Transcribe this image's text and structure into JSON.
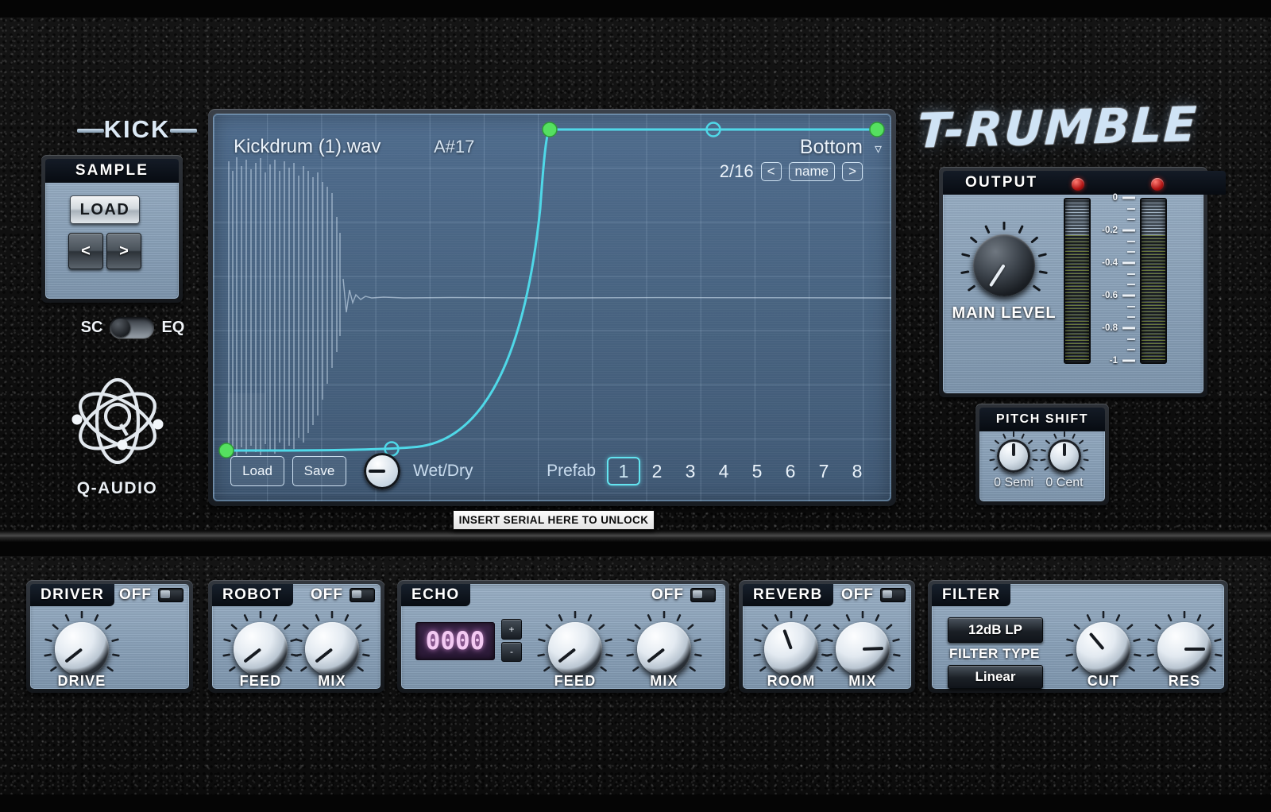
{
  "brand": {
    "plugin_name": "T-RUMBLE",
    "vendor": "Q-AUDIO",
    "vendor_icon": "atom-icon"
  },
  "kick": {
    "title": "KICK",
    "sample_header": "SAMPLE",
    "load_label": "LOAD",
    "prev_label": "<",
    "next_label": ">",
    "toggle_left": "SC",
    "toggle_right": "EQ",
    "toggle_state": "SC"
  },
  "display": {
    "wave_filename": "Kickdrum (1).wav",
    "note": "A#17",
    "preset_name": "Bottom",
    "preset_index": "2/16",
    "preset_prev": "<",
    "preset_name_button": "name",
    "preset_next": ">",
    "caret_icon": "chevron-down-icon",
    "load_label": "Load",
    "save_label": "Save",
    "wetdry_label": "Wet/Dry",
    "prefab_label": "Prefab",
    "prefab_buttons": [
      "1",
      "2",
      "3",
      "4",
      "5",
      "6",
      "7",
      "8"
    ],
    "prefab_selected": "1",
    "curve_color": "#4fd8e8",
    "node_color": "#55e060"
  },
  "serial": {
    "text": "INSERT SERIAL HERE TO UNLOCK"
  },
  "output": {
    "header": "OUTPUT",
    "knob_label": "MAIN LEVEL",
    "led_left": "clip-led",
    "led_right": "clip-led",
    "scale": [
      "0",
      "-0.2",
      "-0.4",
      "-0.6",
      "-0.8",
      "-1"
    ]
  },
  "pitch_shift": {
    "header": "PITCH SHIFT",
    "semi_value": "0 Semi",
    "cent_value": "0 Cent"
  },
  "effects": [
    {
      "name": "DRIVER",
      "power_label": "OFF",
      "power_state": "off",
      "knobs": [
        {
          "label": "DRIVE",
          "angle": -128
        }
      ]
    },
    {
      "name": "ROBOT",
      "power_label": "OFF",
      "power_state": "off",
      "knobs": [
        {
          "label": "FEED",
          "angle": -128
        },
        {
          "label": "MIX",
          "angle": -128
        }
      ]
    },
    {
      "name": "ECHO",
      "power_label": "OFF",
      "power_state": "off",
      "lcd_value": "0000",
      "lcd_inc": "+",
      "lcd_dec": "-",
      "knobs": [
        {
          "label": "FEED",
          "angle": -128
        },
        {
          "label": "MIX",
          "angle": -128
        }
      ]
    },
    {
      "name": "REVERB",
      "power_label": "OFF",
      "power_state": "off",
      "knobs": [
        {
          "label": "ROOM",
          "angle": -20
        },
        {
          "label": "MIX",
          "angle": 88
        }
      ]
    },
    {
      "name": "FILTER",
      "filter_type_value": "12dB LP",
      "filter_type_label": "FILTER TYPE",
      "filter_curve_value": "Linear",
      "knobs": [
        {
          "label": "CUT",
          "angle": -40
        },
        {
          "label": "RES",
          "angle": 90
        }
      ]
    }
  ],
  "chart_data": {
    "type": "line",
    "title": "Envelope curve",
    "xlabel": "",
    "ylabel": "",
    "x": [
      0,
      0.24,
      0.5,
      0.74,
      1.0
    ],
    "y": [
      0,
      0.01,
      1.0,
      1.0,
      1.0
    ],
    "node_types": [
      "anchor",
      "handle",
      "anchor",
      "handle",
      "anchor"
    ]
  }
}
